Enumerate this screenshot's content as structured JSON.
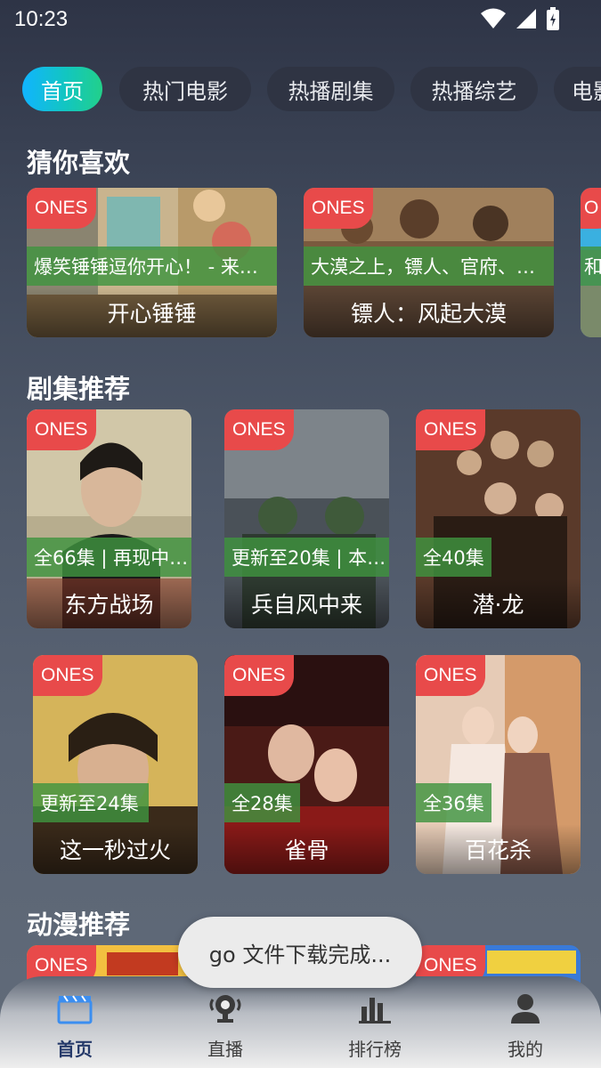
{
  "status_bar": {
    "time": "10:23"
  },
  "tabs": [
    {
      "label": "首页",
      "active": true
    },
    {
      "label": "热门电影",
      "active": false
    },
    {
      "label": "热播剧集",
      "active": false
    },
    {
      "label": "热播综艺",
      "active": false
    },
    {
      "label": "电影",
      "active": false
    }
  ],
  "sections": {
    "guess": {
      "title": "猜你喜欢",
      "items": [
        {
          "badge": "ONES",
          "subtitle": "爆笑锤锤逗你开心！ - 来…",
          "title": "开心锤锤"
        },
        {
          "badge": "ONES",
          "subtitle": "大漠之上，镖人、官府、…",
          "title": "镖人：风起大漠"
        },
        {
          "badge": "O",
          "subtitle": "和",
          "title": ""
        }
      ]
    },
    "drama": {
      "title": "剧集推荐",
      "items": [
        {
          "badge": "ONES",
          "subtitle": "全66集 | 再现中…",
          "title": "东方战场"
        },
        {
          "badge": "ONES",
          "subtitle": "更新至20集 | 本…",
          "title": "兵自风中来"
        },
        {
          "badge": "ONES",
          "subtitle": "全40集",
          "title": "潜·龙"
        },
        {
          "badge": "ONES",
          "subtitle": "更新至24集",
          "title": "这一秒过火"
        },
        {
          "badge": "ONES",
          "subtitle": "全28集",
          "title": "雀骨"
        },
        {
          "badge": "ONES",
          "subtitle": "全36集",
          "title": "百花杀"
        }
      ]
    },
    "anime": {
      "title": "动漫推荐",
      "items": [
        {
          "badge": "ONES"
        },
        {
          "badge": "ONES"
        }
      ]
    }
  },
  "toast": {
    "text": "go 文件下载完成..."
  },
  "bottom_nav": [
    {
      "label": "首页",
      "icon": "clapperboard-icon",
      "active": true
    },
    {
      "label": "直播",
      "icon": "live-icon",
      "active": false
    },
    {
      "label": "排行榜",
      "icon": "bar-chart-icon",
      "active": false
    },
    {
      "label": "我的",
      "icon": "person-icon",
      "active": false
    }
  ],
  "colors": {
    "accent_start": "#11b4ff",
    "accent_end": "#22d08a",
    "badge": "#e84a4a",
    "subtitle_bg": "#409440",
    "nav_active": "#263a6a"
  }
}
